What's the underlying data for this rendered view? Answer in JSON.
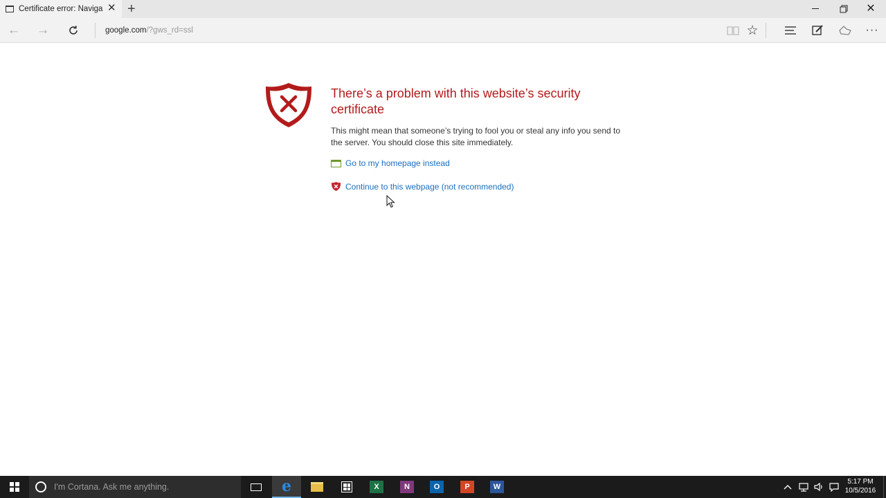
{
  "browser": {
    "tab_title": "Certificate error: Naviga",
    "address_host": "google.com",
    "address_path": "/?gws_rd=ssl"
  },
  "error": {
    "title": "There’s a problem with this website’s security certificate",
    "description": "This might mean that someone’s trying to fool you or steal any info you send to the server. You should close this site immediately.",
    "homepage_link": "Go to my homepage instead",
    "continue_link": "Continue to this webpage (not recommended)"
  },
  "taskbar": {
    "cortana_placeholder": "I'm Cortana. Ask me anything.",
    "apps": [
      {
        "name": "Edge",
        "letter": "e"
      },
      {
        "name": "Excel",
        "letter": "X"
      },
      {
        "name": "OneNote",
        "letter": "N"
      },
      {
        "name": "Outlook",
        "letter": "O"
      },
      {
        "name": "PowerPoint",
        "letter": "P"
      },
      {
        "name": "Word",
        "letter": "W"
      }
    ],
    "time": "5:17 PM",
    "date": "10/5/2016"
  },
  "colors": {
    "error_red": "#b31b1b",
    "link_blue": "#1a6fbf",
    "taskbar_bg": "#1b1b1b"
  }
}
